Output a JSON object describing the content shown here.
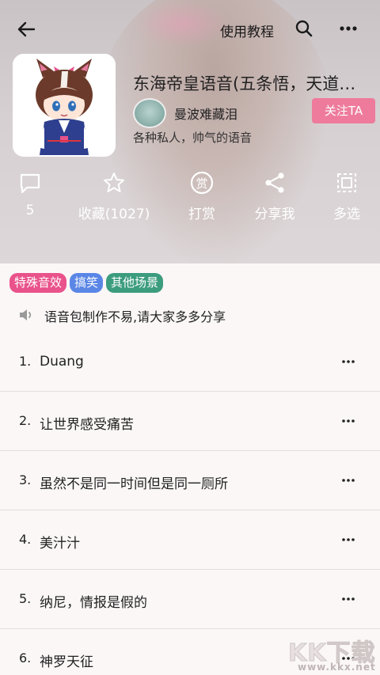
{
  "header": {
    "tutorial_label": "使用教程",
    "icons": [
      "back-arrow-icon",
      "search-icon",
      "more-icon"
    ]
  },
  "pack": {
    "title": "东海帝皇语音(五条悟，天道…",
    "author": "曼波难藏泪",
    "follow_label": "关注TA",
    "description": "各种私人，帅气的语音"
  },
  "actions": [
    {
      "icon": "comment-icon",
      "label": "5"
    },
    {
      "icon": "star-icon",
      "label": "收藏(1027)"
    },
    {
      "icon": "reward-icon",
      "label": "打赏",
      "glyph": "赏"
    },
    {
      "icon": "share-icon",
      "label": "分享我"
    },
    {
      "icon": "multi-select-icon",
      "label": "多选"
    }
  ],
  "tags": [
    {
      "label": "特殊音效",
      "color": "#e9528a"
    },
    {
      "label": "搞笑",
      "color": "#5a86e6"
    },
    {
      "label": "其他场景",
      "color": "#3c9c7e"
    }
  ],
  "notice": "语音包制作不易,请大家多多分享",
  "items": [
    {
      "num": "1.",
      "name": "Duang"
    },
    {
      "num": "2.",
      "name": "让世界感受痛苦"
    },
    {
      "num": "3.",
      "name": "虽然不是同一时间但是同一厕所"
    },
    {
      "num": "4.",
      "name": "美汁汁"
    },
    {
      "num": "5.",
      "name": "纳尼，情报是假的"
    },
    {
      "num": "6.",
      "name": "神罗天征"
    }
  ],
  "watermark": {
    "main": "KK下载",
    "sub": "www.kkx.net"
  },
  "colors": {
    "accent": "#ee7b9c"
  }
}
